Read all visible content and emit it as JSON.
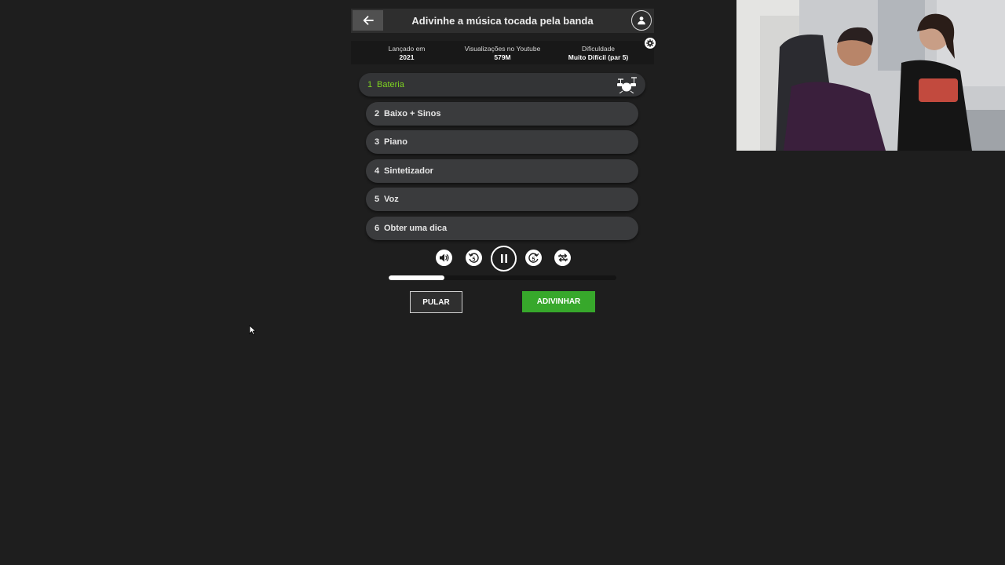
{
  "header": {
    "title": "Adivinhe a música tocada pela banda",
    "back_icon": "arrow-left-icon",
    "profile_icon": "user-icon"
  },
  "info": {
    "released_label": "Lançado em",
    "released_value": "2021",
    "views_label": "Visualizações no Youtube",
    "views_value": "579M",
    "difficulty_label": "Dificuldade",
    "difficulty_value": "Muito Difícil (par 5)",
    "settings_icon": "gear-icon"
  },
  "tracks": [
    {
      "num": "1",
      "label": "Bateria",
      "active": true,
      "icon": "drum-kit-icon"
    },
    {
      "num": "2",
      "label": "Baixo + Sinos"
    },
    {
      "num": "3",
      "label": "Piano"
    },
    {
      "num": "4",
      "label": "Sintetizador"
    },
    {
      "num": "5",
      "label": "Voz"
    },
    {
      "num": "6",
      "label": "Obter uma dica"
    }
  ],
  "player": {
    "volume_icon": "volume-icon",
    "rewind_icon": "rewind-5-icon",
    "pause_icon": "pause-icon",
    "forward_icon": "forward-5-icon",
    "loop_icon": "loop-icon",
    "rewind_label": "5",
    "forward_label": "5",
    "progress": 0.245
  },
  "actions": {
    "skip_label": "PULAR",
    "guess_label": "ADIVINHAR"
  },
  "colors": {
    "background": "#1e1e1e",
    "active_track": "#7ed321",
    "guess_button": "#37a82b"
  }
}
